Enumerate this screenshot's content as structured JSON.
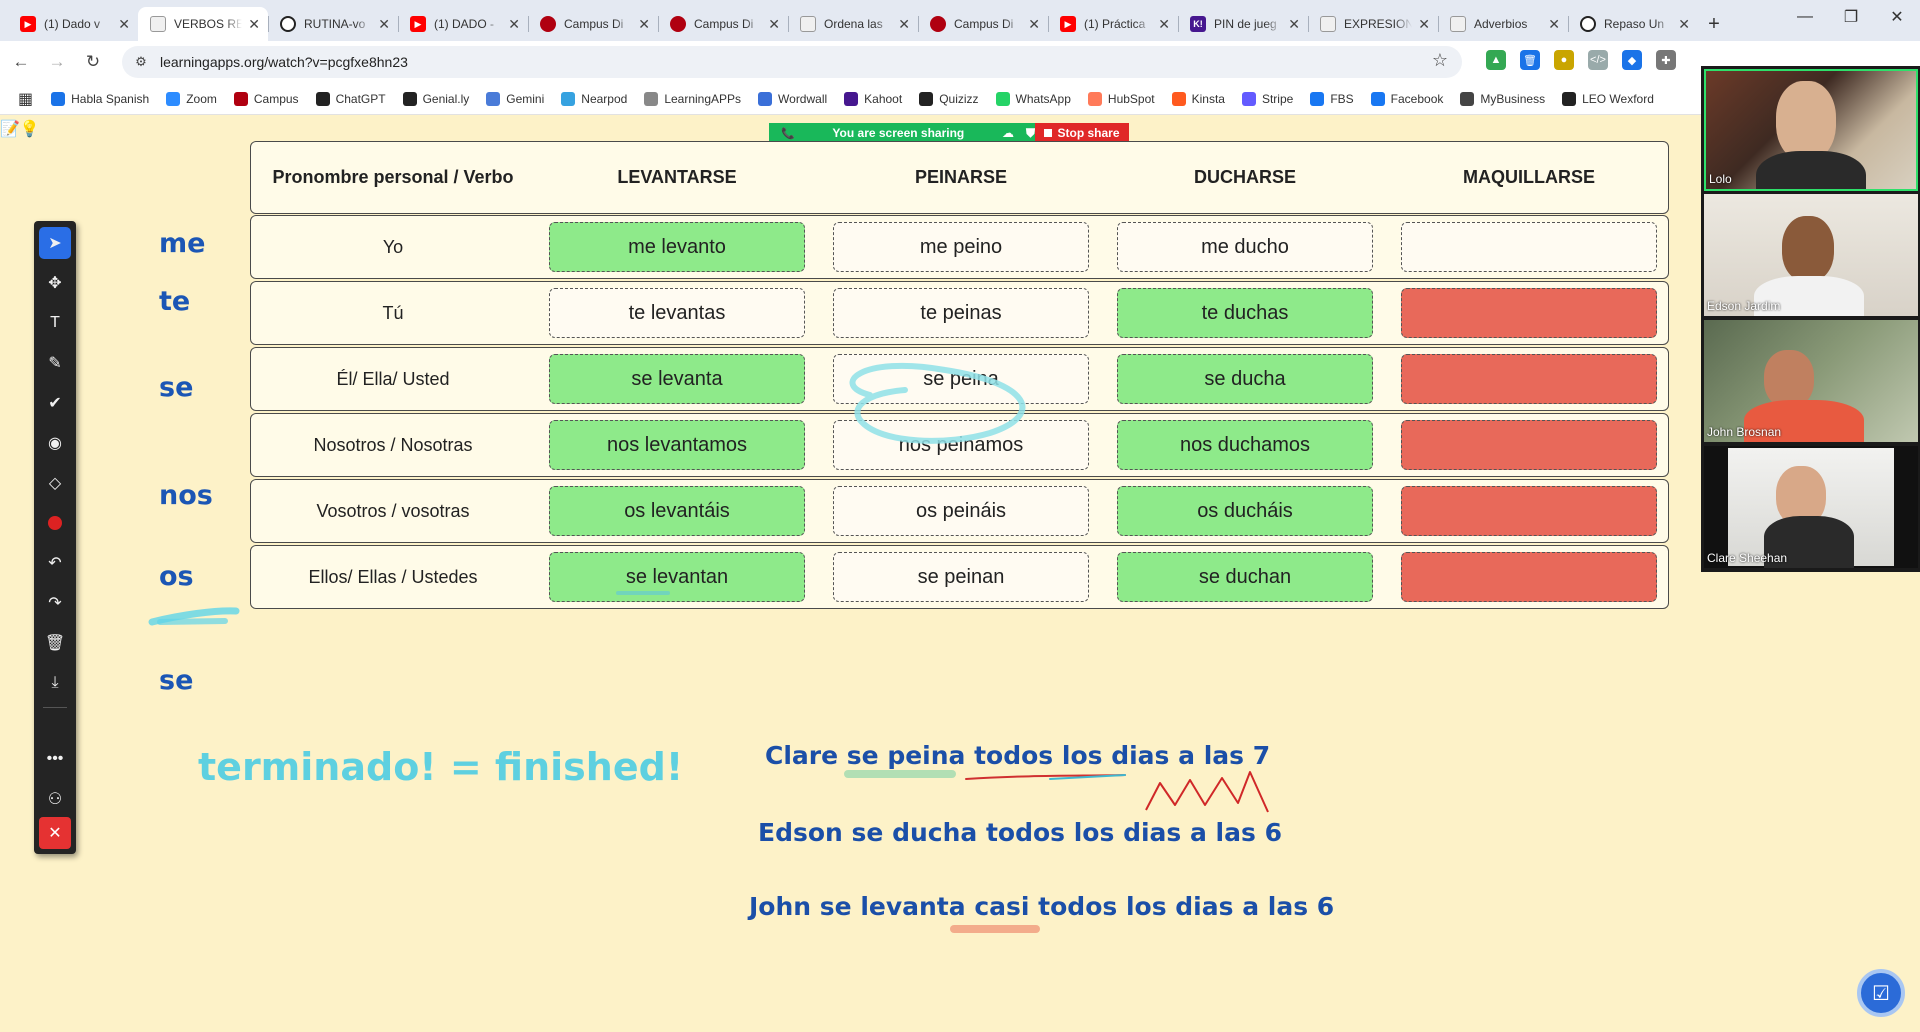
{
  "tabs": [
    {
      "title": "(1) Dado v",
      "fav": "yt",
      "active": false
    },
    {
      "title": "VERBOS RE",
      "fav": "la",
      "active": true
    },
    {
      "title": "RUTINA-vo",
      "fav": "gl",
      "active": false
    },
    {
      "title": "(1) DADO -",
      "fav": "yt",
      "active": false
    },
    {
      "title": "Campus Di",
      "fav": "cp",
      "active": false
    },
    {
      "title": "Campus Di",
      "fav": "cp",
      "active": false
    },
    {
      "title": "Ordena las",
      "fav": "la",
      "active": false
    },
    {
      "title": "Campus Di",
      "fav": "cp",
      "active": false
    },
    {
      "title": "(1) Práctica",
      "fav": "yt",
      "active": false
    },
    {
      "title": "PIN de jueg",
      "fav": "kp",
      "active": false
    },
    {
      "title": "EXPRESION",
      "fav": "la",
      "active": false
    },
    {
      "title": "Adverbios",
      "fav": "la",
      "active": false
    },
    {
      "title": "Repaso Un",
      "fav": "gl",
      "active": false
    }
  ],
  "address": {
    "url": "learningapps.org/watch?v=pcgfxe8hn23"
  },
  "bookmarks": [
    {
      "label": "Habla Spanish",
      "icon": "search-icon",
      "color": "#1a73e8"
    },
    {
      "label": "Zoom",
      "icon": "zoom-icon",
      "color": "#2d8cff"
    },
    {
      "label": "Campus",
      "icon": "dash-icon",
      "color": "#b00010"
    },
    {
      "label": "ChatGPT",
      "icon": "chatgpt-icon",
      "color": "#222222"
    },
    {
      "label": "Genial.ly",
      "icon": "genially-icon",
      "color": "#222222"
    },
    {
      "label": "Gemini",
      "icon": "sparkle-icon",
      "color": "#4a7bd8"
    },
    {
      "label": "Nearpod",
      "icon": "nearpod-icon",
      "color": "#36a2e0"
    },
    {
      "label": "LearningAPPs",
      "icon": "learningapps-icon",
      "color": "#888888"
    },
    {
      "label": "Wordwall",
      "icon": "wordwall-icon",
      "color": "#3a6fd8"
    },
    {
      "label": "Kahoot",
      "icon": "kahoot-icon",
      "color": "#46178f"
    },
    {
      "label": "Quizizz",
      "icon": "quizizz-icon",
      "color": "#222222"
    },
    {
      "label": "WhatsApp",
      "icon": "whatsapp-icon",
      "color": "#25d366"
    },
    {
      "label": "HubSpot",
      "icon": "hubspot-icon",
      "color": "#ff7a59"
    },
    {
      "label": "Kinsta",
      "icon": "kinsta-icon",
      "color": "#ff5a1f"
    },
    {
      "label": "Stripe",
      "icon": "stripe-icon",
      "color": "#635bff"
    },
    {
      "label": "FBS",
      "icon": "meta-icon",
      "color": "#1877f2"
    },
    {
      "label": "Facebook",
      "icon": "facebook-icon",
      "color": "#1877f2"
    },
    {
      "label": "MyBusiness",
      "icon": "google-icon",
      "color": "#444444"
    },
    {
      "label": "LEO Wexford",
      "icon": "globe-icon",
      "color": "#222222"
    }
  ],
  "share_bar": {
    "sharing_text": "You are screen sharing",
    "stop_label": "Stop share"
  },
  "pronoun_column": [
    "me",
    "te",
    "se",
    "nos",
    "os",
    "se"
  ],
  "table": {
    "headers": [
      "Pronombre personal / Verbo",
      "LEVANTARSE",
      "PEINARSE",
      "DUCHARSE",
      "MAQUILLARSE"
    ],
    "rows": [
      {
        "pronoun": "Yo",
        "cells": [
          {
            "text": "me levanto",
            "state": "green"
          },
          {
            "text": "me peino",
            "state": "empty"
          },
          {
            "text": "me ducho",
            "state": "empty"
          },
          {
            "text": "",
            "state": "empty"
          }
        ]
      },
      {
        "pronoun": "Tú",
        "cells": [
          {
            "text": "te levantas",
            "state": "empty"
          },
          {
            "text": "te peinas",
            "state": "empty"
          },
          {
            "text": "te duchas",
            "state": "green"
          },
          {
            "text": "",
            "state": "red"
          }
        ]
      },
      {
        "pronoun": "Él/ Ella/ Usted",
        "cells": [
          {
            "text": "se levanta",
            "state": "green"
          },
          {
            "text": "se peina",
            "state": "empty"
          },
          {
            "text": "se ducha",
            "state": "green"
          },
          {
            "text": "",
            "state": "red"
          }
        ]
      },
      {
        "pronoun": "Nosotros / Nosotras",
        "cells": [
          {
            "text": "nos levantamos",
            "state": "green"
          },
          {
            "text": "nos peinamos",
            "state": "empty"
          },
          {
            "text": "nos duchamos",
            "state": "green"
          },
          {
            "text": "",
            "state": "red"
          }
        ]
      },
      {
        "pronoun": "Vosotros / vosotras",
        "cells": [
          {
            "text": "os levantáis",
            "state": "green"
          },
          {
            "text": "os peináis",
            "state": "empty"
          },
          {
            "text": "os ducháis",
            "state": "green"
          },
          {
            "text": "",
            "state": "red"
          }
        ]
      },
      {
        "pronoun": "Ellos/ Ellas / Ustedes",
        "cells": [
          {
            "text": "se levantan",
            "state": "green"
          },
          {
            "text": "se peinan",
            "state": "empty"
          },
          {
            "text": "se duchan",
            "state": "green"
          },
          {
            "text": "",
            "state": "red"
          }
        ]
      }
    ]
  },
  "notes": {
    "terminado": "terminado! = finished!",
    "sentence1": "Clare se peina todos los dias a las 7",
    "sentence2": "Edson se ducha todos los dias a las 6",
    "sentence3": "John se levanta casi todos los dias a las 6"
  },
  "participants": [
    "Lolo",
    "Edson Jardim",
    "John Brosnan",
    "Clare Sheehan"
  ],
  "colors": {
    "page_bg": "#fdf2c8",
    "correct": "#8eea8a",
    "incorrect": "#e8695a",
    "pronoun_blue": "#1b56b5",
    "note_cyan": "#5ed0e0"
  }
}
